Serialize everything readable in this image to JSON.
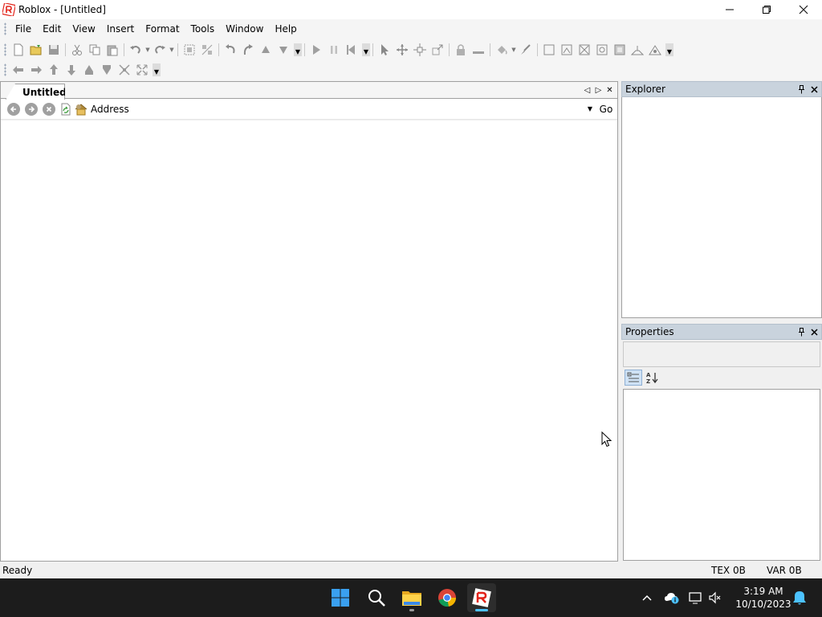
{
  "window": {
    "title": "Roblox - [Untitled]"
  },
  "menu": [
    "File",
    "Edit",
    "View",
    "Insert",
    "Format",
    "Tools",
    "Window",
    "Help"
  ],
  "document": {
    "tab_label": "Untitled",
    "address_label": "Address",
    "address_value": "",
    "go_label": "Go"
  },
  "explorer": {
    "title": "Explorer"
  },
  "properties": {
    "title": "Properties"
  },
  "status": {
    "text": "Ready",
    "tex": "TEX 0B",
    "var": "VAR 0B"
  },
  "taskbar": {
    "time": "3:19 AM",
    "date": "10/10/2023",
    "apps": [
      "start-icon",
      "search-icon",
      "file-explorer-icon",
      "chrome-icon",
      "roblox-studio-icon"
    ]
  },
  "colors": {
    "panel_header": "#c9d3dd",
    "taskbar_bg": "#1c1c1c",
    "active_indicator": "#4cc2ff",
    "roblox_red": "#e2231a"
  }
}
